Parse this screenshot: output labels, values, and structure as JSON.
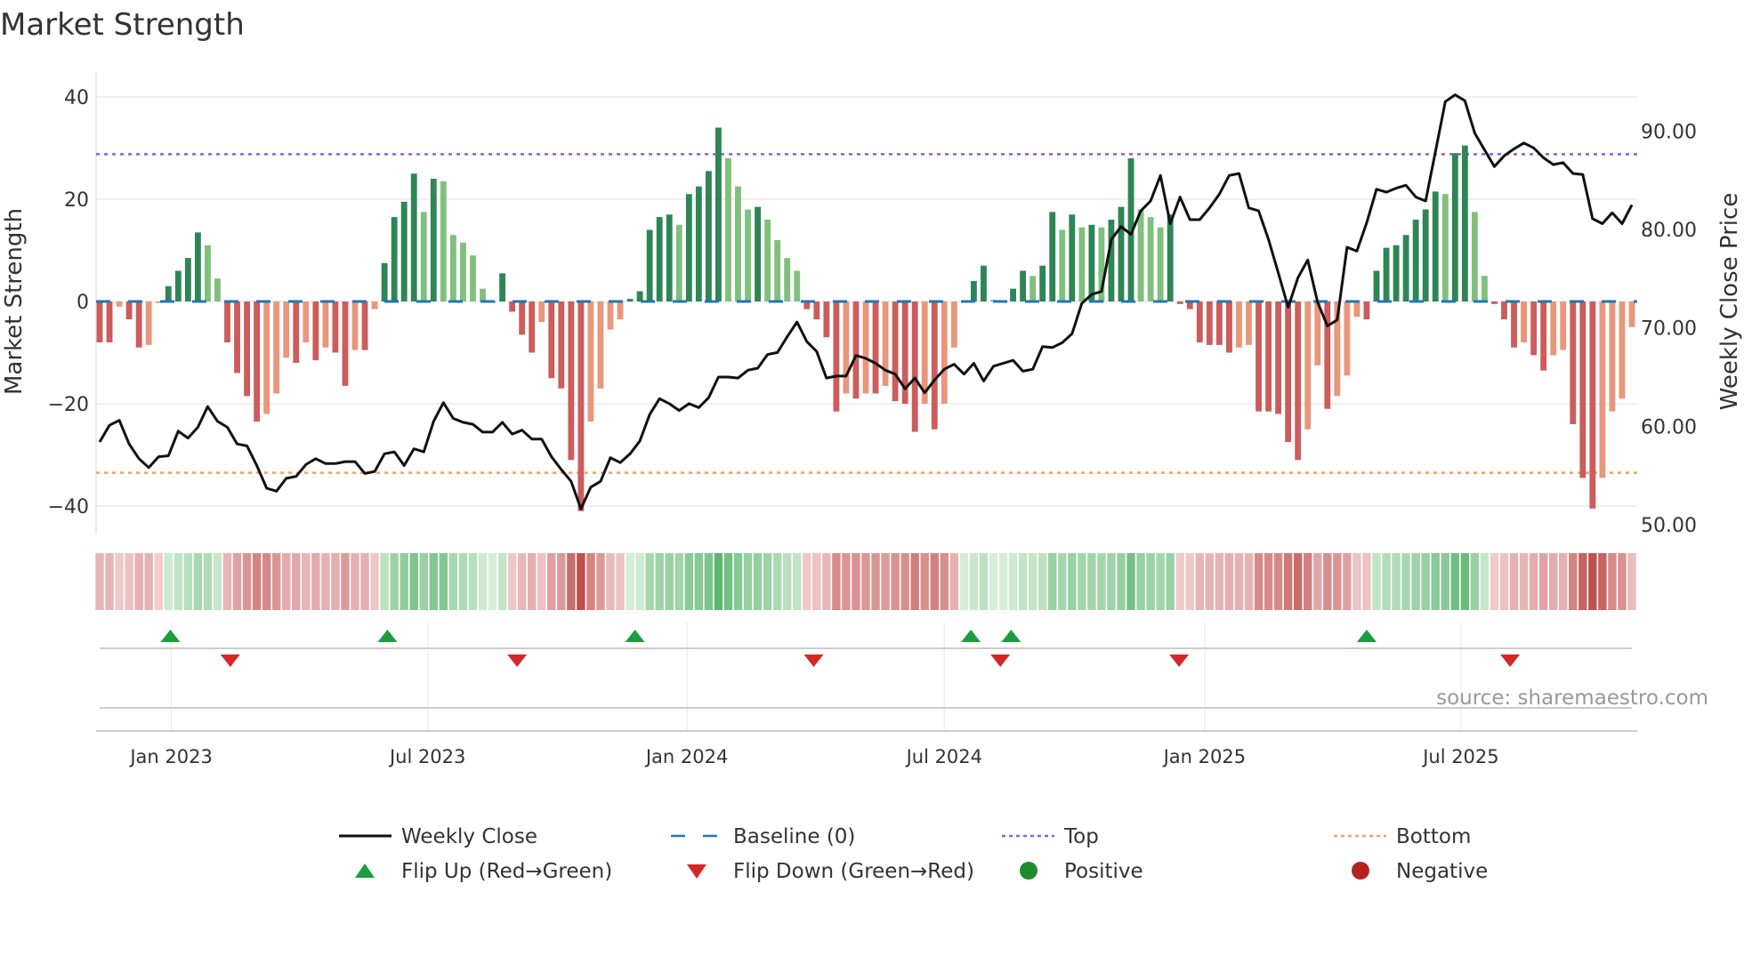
{
  "chart_data": {
    "type": "bar",
    "title": "Market Strength",
    "ylabel": "Market Strength",
    "y2label": "Weekly Close Price",
    "ylim": [
      -45,
      44
    ],
    "y2lim": [
      48.2,
      95.9
    ],
    "yticks": [
      40,
      20,
      0,
      -20,
      -40
    ],
    "ytick_labels": [
      "40",
      "20",
      "0",
      "−20",
      "−40"
    ],
    "y2ticks": [
      90,
      80,
      70,
      60,
      50
    ],
    "y2tick_labels": [
      "90.00",
      "80.00",
      "70.00",
      "60.00",
      "50.00"
    ],
    "x_ticks": [
      {
        "label": "Jan 2023",
        "week_index": 7.3
      },
      {
        "label": "Jul 2023",
        "week_index": 33.4
      },
      {
        "label": "Jan 2024",
        "week_index": 59.8
      },
      {
        "label": "Jul 2024",
        "week_index": 86.0
      },
      {
        "label": "Jan 2025",
        "week_index": 112.5
      },
      {
        "label": "Jul 2025",
        "week_index": 138.6
      }
    ],
    "top_level": 28.8,
    "bottom_level": -33.5,
    "baseline": 0,
    "strength": [
      -8,
      -8,
      -1,
      -3.5,
      -9,
      -8.5,
      -0.3,
      3,
      6,
      8.5,
      13.5,
      11,
      4.5,
      -8,
      -14,
      -18.5,
      -23.5,
      -22,
      -18,
      -11,
      -12,
      -8,
      -11.5,
      -9,
      -10,
      -16.5,
      -9.5,
      -9.5,
      -1.5,
      7.5,
      16.5,
      19.5,
      25,
      17.5,
      24,
      23.5,
      13,
      11.5,
      9,
      2.5,
      0,
      5.5,
      -2,
      -6.5,
      -10,
      -4,
      -15,
      -17,
      -31,
      -41,
      -23.5,
      -17,
      -5.5,
      -3.5,
      0.5,
      2,
      14,
      16.5,
      17,
      15,
      21,
      22.5,
      25.5,
      34,
      28,
      22.5,
      18,
      18.5,
      16,
      12,
      8.5,
      6,
      -1.5,
      -3.5,
      -7,
      -21.5,
      -18,
      -19,
      -18,
      -18,
      -16.5,
      -19.5,
      -20,
      -25.5,
      -20,
      -25,
      -20,
      -9,
      0.2,
      4,
      7,
      0.3,
      0,
      2.5,
      6,
      5,
      7,
      17.5,
      14,
      17,
      14.5,
      15,
      14.5,
      16,
      18.5,
      28,
      18,
      16.5,
      14.5,
      17,
      -0.5,
      -1.5,
      -8,
      -8.5,
      -8.5,
      -10,
      -9,
      -8.5,
      -21.5,
      -21.5,
      -22,
      -27.5,
      -31,
      -25,
      -12.5,
      -21,
      -18.5,
      -14.5,
      -3,
      -3.5,
      6,
      10.5,
      11,
      13,
      16,
      18,
      21.5,
      21,
      29,
      30.5,
      17.5,
      5,
      -0.5,
      -3.5,
      -9,
      -8,
      -10.5,
      -13.5,
      -10.5,
      -9.5,
      -24,
      -34.5,
      -40.5,
      -34.5,
      -21.5,
      -19,
      -5
    ],
    "weekly_close": [
      58.4,
      60.1,
      60.6,
      58.2,
      56.7,
      55.8,
      56.9,
      57.0,
      59.5,
      58.8,
      59.9,
      62.0,
      60.5,
      59.9,
      58.2,
      58.0,
      56.0,
      53.7,
      53.4,
      54.7,
      54.9,
      56.1,
      56.7,
      56.2,
      56.2,
      56.4,
      56.4,
      55.2,
      55.4,
      57.2,
      57.4,
      56.0,
      57.7,
      57.4,
      60.5,
      62.4,
      60.8,
      60.4,
      60.2,
      59.4,
      59.4,
      60.4,
      59.2,
      59.6,
      58.7,
      58.7,
      56.9,
      55.6,
      54.4,
      51.6,
      53.8,
      54.4,
      56.8,
      56.3,
      57.2,
      58.5,
      61.2,
      62.8,
      62.3,
      61.6,
      62.3,
      61.9,
      62.9,
      65.0,
      65.0,
      64.9,
      65.7,
      65.9,
      67.3,
      67.5,
      69.1,
      70.6,
      68.6,
      67.6,
      64.9,
      65.1,
      65.1,
      67.2,
      66.9,
      66.4,
      65.7,
      65.3,
      63.8,
      64.9,
      63.4,
      64.7,
      65.8,
      66.3,
      65.3,
      66.4,
      64.6,
      66.1,
      66.4,
      66.7,
      65.6,
      65.8,
      68.1,
      68.0,
      68.5,
      69.4,
      72.5,
      73.4,
      73.7,
      79.0,
      80.3,
      79.5,
      81.9,
      82.9,
      85.5,
      80.6,
      83.3,
      81.0,
      81.0,
      82.2,
      83.6,
      85.5,
      85.7,
      82.2,
      81.9,
      79.0,
      75.6,
      72.1,
      75.1,
      76.9,
      72.6,
      70.2,
      70.8,
      78.2,
      77.8,
      80.7,
      84.1,
      83.8,
      84.2,
      84.5,
      83.3,
      82.9,
      87.9,
      93.0,
      93.7,
      93.1,
      89.8,
      88.1,
      86.4,
      87.5,
      88.2,
      88.8,
      88.3,
      87.3,
      86.6,
      86.8,
      85.7,
      85.6,
      81.1,
      80.6,
      81.7,
      80.6,
      82.5
    ],
    "flip_up_week_index": [
      7.2,
      29.3,
      54.5,
      88.7,
      92.8,
      129
    ],
    "flip_down_week_index": [
      13.3,
      42.5,
      72.7,
      91.7,
      109.9,
      143.6
    ],
    "legend": {
      "placement": "bottom",
      "items": [
        {
          "label": "Weekly Close",
          "symbol": "line"
        },
        {
          "label": "Baseline (0)",
          "symbol": "dash"
        },
        {
          "label": "Top",
          "symbol": "dot-purple"
        },
        {
          "label": "Bottom",
          "symbol": "dot-orange"
        },
        {
          "label": "Flip Up (Red→Green)",
          "symbol": "triangle-up"
        },
        {
          "label": "Flip Down (Green→Red)",
          "symbol": "triangle-down"
        },
        {
          "label": "Positive",
          "symbol": "circle-green"
        },
        {
          "label": "Negative",
          "symbol": "circle-red"
        }
      ]
    },
    "source": "source: sharemaestro.com",
    "colors": {
      "pos_dark": "#2e8555",
      "pos_light": "#80c07d",
      "neg_dark": "#cd5c5c",
      "neg_light": "#e9977b",
      "line": "#111111",
      "baseline": "#1f77b4",
      "top": "#9b59d6",
      "bottom": "#f0a060",
      "flip_up": "#1a9e3f",
      "flip_down": "#d62728",
      "positive": "#1f8a2e",
      "negative": "#b22222"
    }
  }
}
